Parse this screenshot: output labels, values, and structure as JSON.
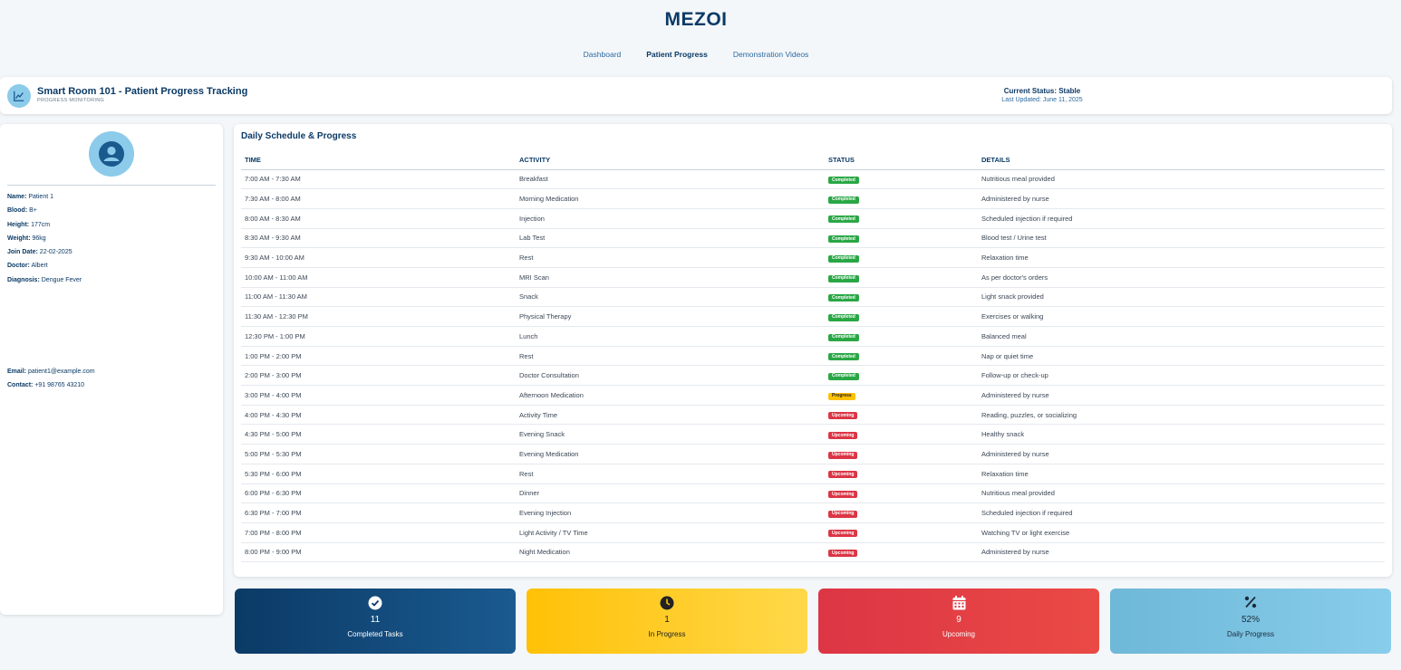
{
  "app": {
    "brand": "MEZOI"
  },
  "nav": [
    {
      "label": "Dashboard",
      "active": false
    },
    {
      "label": "Patient Progress",
      "active": true
    },
    {
      "label": "Demonstration Videos",
      "active": false
    }
  ],
  "header": {
    "icon": "chart-line-icon",
    "title": "Smart Room 101 - Patient Progress Tracking",
    "subtitle": "PROGRESS MONITORING",
    "status": "Current Status: Stable",
    "updated": "Last Updated: June 11, 2025"
  },
  "patient": {
    "avatar_icon": "user-avatar-icon",
    "fields": [
      {
        "label": "Name:",
        "value": "Patient 1"
      },
      {
        "label": "Blood:",
        "value": "B+"
      },
      {
        "label": "Height:",
        "value": "177cm"
      },
      {
        "label": "Weight:",
        "value": "96kg"
      },
      {
        "label": "Join Date:",
        "value": "22-02-2025"
      },
      {
        "label": "Doctor:",
        "value": "Albert"
      },
      {
        "label": "Diagnosis:",
        "value": "Dengue Fever"
      }
    ],
    "contact": [
      {
        "label": "Email:",
        "value": "patient1@example.com"
      },
      {
        "label": "Contact:",
        "value": "+91 98765 43210"
      }
    ]
  },
  "schedule": {
    "title": "Daily Schedule & Progress",
    "columns": [
      "TIME",
      "ACTIVITY",
      "STATUS",
      "DETAILS"
    ],
    "rows": [
      {
        "time": "7:00 AM - 7:30 AM",
        "activity": "Breakfast",
        "status": "Completed",
        "details": "Nutritious meal provided"
      },
      {
        "time": "7:30 AM - 8:00 AM",
        "activity": "Morning Medication",
        "status": "Completed",
        "details": "Administered by nurse"
      },
      {
        "time": "8:00 AM - 8:30 AM",
        "activity": "Injection",
        "status": "Completed",
        "details": "Scheduled injection if required"
      },
      {
        "time": "8:30 AM - 9:30 AM",
        "activity": "Lab Test",
        "status": "Completed",
        "details": "Blood test / Urine test"
      },
      {
        "time": "9:30 AM - 10:00 AM",
        "activity": "Rest",
        "status": "Completed",
        "details": "Relaxation time"
      },
      {
        "time": "10:00 AM - 11:00 AM",
        "activity": "MRI Scan",
        "status": "Completed",
        "details": "As per doctor's orders"
      },
      {
        "time": "11:00 AM - 11:30 AM",
        "activity": "Snack",
        "status": "Completed",
        "details": "Light snack provided"
      },
      {
        "time": "11:30 AM - 12:30 PM",
        "activity": "Physical Therapy",
        "status": "Completed",
        "details": "Exercises or walking"
      },
      {
        "time": "12:30 PM - 1:00 PM",
        "activity": "Lunch",
        "status": "Completed",
        "details": "Balanced meal"
      },
      {
        "time": "1:00 PM - 2:00 PM",
        "activity": "Rest",
        "status": "Completed",
        "details": "Nap or quiet time"
      },
      {
        "time": "2:00 PM - 3:00 PM",
        "activity": "Doctor Consultation",
        "status": "Completed",
        "details": "Follow-up or check-up"
      },
      {
        "time": "3:00 PM - 4:00 PM",
        "activity": "Afternoon Medication",
        "status": "Progress",
        "details": "Administered by nurse"
      },
      {
        "time": "4:00 PM - 4:30 PM",
        "activity": "Activity Time",
        "status": "Upcoming",
        "details": "Reading, puzzles, or socializing"
      },
      {
        "time": "4:30 PM - 5:00 PM",
        "activity": "Evening Snack",
        "status": "Upcoming",
        "details": "Healthy snack"
      },
      {
        "time": "5:00 PM - 5:30 PM",
        "activity": "Evening Medication",
        "status": "Upcoming",
        "details": "Administered by nurse"
      },
      {
        "time": "5:30 PM - 6:00 PM",
        "activity": "Rest",
        "status": "Upcoming",
        "details": "Relaxation time"
      },
      {
        "time": "6:00 PM - 6:30 PM",
        "activity": "Dinner",
        "status": "Upcoming",
        "details": "Nutritious meal provided"
      },
      {
        "time": "6:30 PM - 7:00 PM",
        "activity": "Evening Injection",
        "status": "Upcoming",
        "details": "Scheduled injection if required"
      },
      {
        "time": "7:00 PM - 8:00 PM",
        "activity": "Light Activity / TV Time",
        "status": "Upcoming",
        "details": "Watching TV or light exercise"
      },
      {
        "time": "8:00 PM - 9:00 PM",
        "activity": "Night Medication",
        "status": "Upcoming",
        "details": "Administered by nurse"
      }
    ]
  },
  "stats": [
    {
      "icon": "check-circle-icon",
      "value": "11",
      "label": "Completed Tasks"
    },
    {
      "icon": "clock-icon",
      "value": "1",
      "label": "In Progress"
    },
    {
      "icon": "calendar-icon",
      "value": "9",
      "label": "Upcoming"
    },
    {
      "icon": "percent-icon",
      "value": "52%",
      "label": "Daily Progress"
    }
  ],
  "colors": {
    "brand": "#0b3a66",
    "completed": "#29a745",
    "progress": "#ffc107",
    "upcoming": "#dc3545",
    "accent_light": "#8ccbea"
  }
}
